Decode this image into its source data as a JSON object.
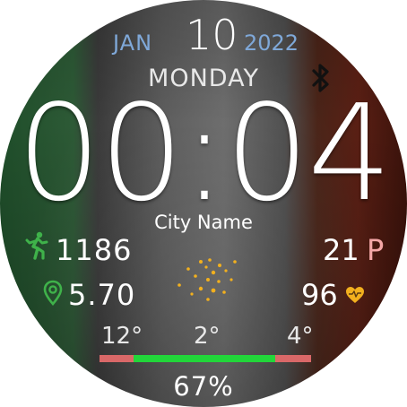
{
  "date": {
    "month": "JAN",
    "day": "10",
    "year": "2022",
    "weekday": "MONDAY"
  },
  "time": "00:04",
  "location": "City Name",
  "activity": {
    "steps": "1186",
    "distance": "5.70",
    "floors": "21",
    "floors_unit": "P",
    "heart_rate": "96"
  },
  "weather": {
    "low": "12°",
    "current": "2°",
    "high": "4°",
    "icon": "weather-dots-icon"
  },
  "battery": "67%",
  "colors": {
    "date_accent": "#7fa8d8",
    "steps_icon": "#3fb24a",
    "distance_icon": "#3fb24a",
    "heart_icon": "#f2b01e",
    "weather_icon": "#f2b01e",
    "bar_green": "#22d63a",
    "bar_red": "#d96868",
    "floors_unit": "#f4a7a7"
  },
  "icons": {
    "bluetooth": "bluetooth-icon",
    "steps": "running-icon",
    "distance": "location-pin-icon",
    "heart": "heart-icon"
  }
}
